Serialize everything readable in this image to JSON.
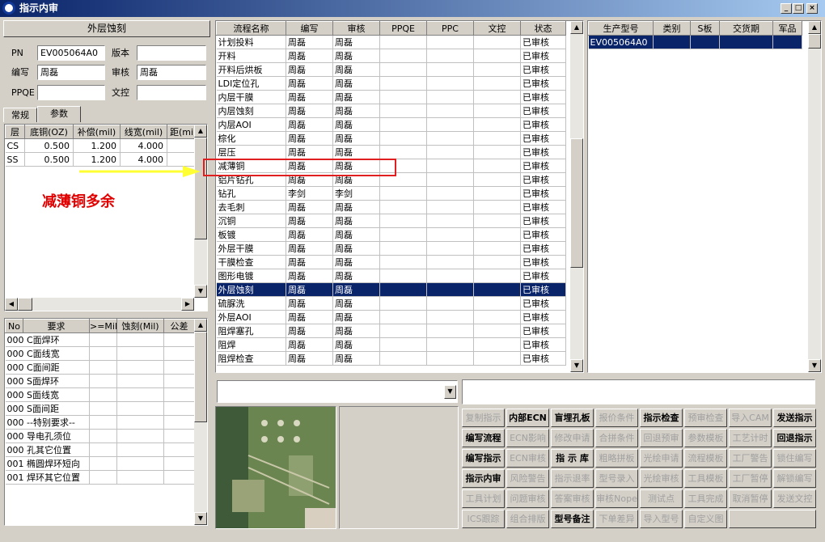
{
  "window": {
    "title": "指示内审"
  },
  "left": {
    "panel_title": "外层蚀刻",
    "pn_label": "PN",
    "pn_value": "EV005064A0",
    "version_label": "版本",
    "version_value": "",
    "author_label": "编写",
    "author_value": "周磊",
    "review_label": "审核",
    "review_value": "周磊",
    "ppqe_label": "PPQE",
    "ppqe_value": "",
    "doc_label": "文控",
    "doc_value": "",
    "tabs": [
      "常规",
      "参数"
    ],
    "layer_table": {
      "headers": [
        "层",
        "底铜(OZ)",
        "补偿(mil)",
        "线宽(mil)",
        "距(mi"
      ],
      "rows": [
        [
          "CS",
          "0.500",
          "1.200",
          "4.000",
          ""
        ],
        [
          "SS",
          "0.500",
          "1.200",
          "4.000",
          ""
        ]
      ]
    },
    "annotation": "减薄铜多余",
    "req_table": {
      "headers": [
        "No",
        "要求",
        ">=Mil",
        "蚀刻(Mil)",
        "公差"
      ],
      "rows": [
        [
          "000",
          "C面焊环"
        ],
        [
          "000",
          "C面线宽"
        ],
        [
          "000",
          "C面间距"
        ],
        [
          "000",
          "S面焊环"
        ],
        [
          "000",
          "S面线宽"
        ],
        [
          "000",
          "S面间距"
        ],
        [
          "000",
          "--特别要求--"
        ],
        [
          "000",
          "导电孔须位"
        ],
        [
          "000",
          "孔其它位置"
        ],
        [
          "001",
          "椭圆焊环短向"
        ],
        [
          "001",
          "焊环其它位置"
        ]
      ]
    }
  },
  "process": {
    "headers": [
      "流程名称",
      "编写",
      "审核",
      "PPQE",
      "PPC",
      "文控",
      "状态"
    ],
    "rows": [
      [
        "计划投料",
        "周磊",
        "周磊",
        "",
        "",
        "",
        "已审核"
      ],
      [
        "开料",
        "周磊",
        "周磊",
        "",
        "",
        "",
        "已审核"
      ],
      [
        "开料后烘板",
        "周磊",
        "周磊",
        "",
        "",
        "",
        "已审核"
      ],
      [
        "LDI定位孔",
        "周磊",
        "周磊",
        "",
        "",
        "",
        "已审核"
      ],
      [
        "内层干膜",
        "周磊",
        "周磊",
        "",
        "",
        "",
        "已审核"
      ],
      [
        "内层蚀刻",
        "周磊",
        "周磊",
        "",
        "",
        "",
        "已审核"
      ],
      [
        "内层AOI",
        "周磊",
        "周磊",
        "",
        "",
        "",
        "已审核"
      ],
      [
        "棕化",
        "周磊",
        "周磊",
        "",
        "",
        "",
        "已审核"
      ],
      [
        "层压",
        "周磊",
        "周磊",
        "",
        "",
        "",
        "已审核"
      ],
      [
        "减薄铜",
        "周磊",
        "周磊",
        "",
        "",
        "",
        "已审核"
      ],
      [
        "铝片钻孔",
        "周磊",
        "周磊",
        "",
        "",
        "",
        "已审核"
      ],
      [
        "钻孔",
        "李剑",
        "李剑",
        "",
        "",
        "",
        "已审核"
      ],
      [
        "去毛刺",
        "周磊",
        "周磊",
        "",
        "",
        "",
        "已审核"
      ],
      [
        "沉铜",
        "周磊",
        "周磊",
        "",
        "",
        "",
        "已审核"
      ],
      [
        "板镀",
        "周磊",
        "周磊",
        "",
        "",
        "",
        "已审核"
      ],
      [
        "外层干膜",
        "周磊",
        "周磊",
        "",
        "",
        "",
        "已审核"
      ],
      [
        "干膜检查",
        "周磊",
        "周磊",
        "",
        "",
        "",
        "已审核"
      ],
      [
        "图形电镀",
        "周磊",
        "周磊",
        "",
        "",
        "",
        "已审核"
      ],
      [
        "外层蚀刻",
        "周磊",
        "周磊",
        "",
        "",
        "",
        "已审核"
      ],
      [
        "硫脲洗",
        "周磊",
        "周磊",
        "",
        "",
        "",
        "已审核"
      ],
      [
        "外层AOI",
        "周磊",
        "周磊",
        "",
        "",
        "",
        "已审核"
      ],
      [
        "阻焊塞孔",
        "周磊",
        "周磊",
        "",
        "",
        "",
        "已审核"
      ],
      [
        "阻焊",
        "周磊",
        "周磊",
        "",
        "",
        "",
        "已审核"
      ],
      [
        "阻焊检查",
        "周磊",
        "周磊",
        "",
        "",
        "",
        "已审核"
      ]
    ]
  },
  "right_table": {
    "headers": [
      "生产型号",
      "类别",
      "S板",
      "交货期",
      "军品"
    ],
    "rows": [
      [
        "EV005064A0",
        "",
        "",
        "",
        ""
      ]
    ]
  },
  "buttons": [
    [
      "复制指示",
      "内部ECN",
      "盲埋孔板",
      "报价条件",
      "指示检查",
      "预审检查",
      "导入CAM",
      "发送指示"
    ],
    [
      "编写流程",
      "ECN影响",
      "修改申请",
      "合拼条件",
      "回退预审",
      "参数模板",
      "工艺计时",
      "回退指示"
    ],
    [
      "编写指示",
      "ECN审核",
      "指 示 库",
      "粗略拼板",
      "光绘申请",
      "流程模板",
      "工厂警告",
      "锁住编写"
    ],
    [
      "指示内审",
      "风险警告",
      "指示退率",
      "型号录入",
      "光绘审核",
      "工具模板",
      "工厂暂停",
      "解锁编写"
    ],
    [
      "工具计划",
      "问题审核",
      "答案审核",
      "审核Nope",
      "测试点",
      "工具完成",
      "取消暂停",
      "发送文控"
    ],
    [
      "ICS跟踪",
      "组合排版",
      "型号备注",
      "下单差异",
      "导入型号",
      "自定义图",
      ""
    ]
  ],
  "button_active": [
    [
      0,
      1,
      1,
      0,
      1,
      0,
      0,
      1
    ],
    [
      1,
      0,
      0,
      0,
      0,
      0,
      0,
      1
    ],
    [
      1,
      0,
      1,
      0,
      0,
      0,
      0,
      0
    ],
    [
      1,
      0,
      0,
      0,
      0,
      0,
      0,
      0
    ],
    [
      0,
      0,
      0,
      0,
      0,
      0,
      0,
      0
    ],
    [
      0,
      0,
      1,
      0,
      0,
      0,
      0
    ]
  ]
}
